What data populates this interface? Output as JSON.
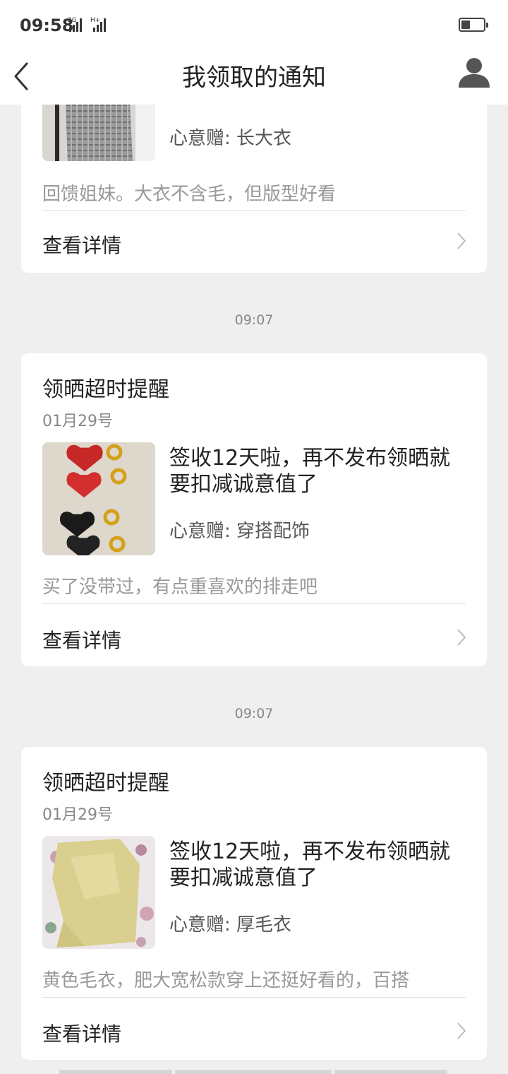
{
  "status_bar": {
    "time": "09:58",
    "network_label_1": "2G",
    "network_label_2": "H+",
    "battery_icon": "battery-icon"
  },
  "header": {
    "title": "我领取的通知",
    "back_icon": "back-arrow-icon",
    "user_icon": "user-icon"
  },
  "cards": [
    {
      "gift": "心意赠: 长大衣",
      "description": "回馈姐妹。大衣不含毛，但版型好看",
      "detail_label": "查看详情",
      "thumb": "coat-photo"
    },
    {
      "time": "09:07",
      "title": "领晒超时提醒",
      "date": "01月29号",
      "headline": "签收12天啦，再不发布领晒就要扣减诚意值了",
      "gift": "心意赠: 穿搭配饰",
      "description": "买了没带过，有点重喜欢的排走吧",
      "detail_label": "查看详情",
      "thumb": "heart-earrings-photo"
    },
    {
      "time": "09:07",
      "title": "领晒超时提醒",
      "date": "01月29号",
      "headline": "签收12天啦，再不发布领晒就要扣减诚意值了",
      "gift": "心意赠: 厚毛衣",
      "description": "黄色毛衣，肥大宽松款穿上还挺好看的，百搭",
      "detail_label": "查看详情",
      "thumb": "yellow-sweater-photo"
    }
  ],
  "colors": {
    "background": "#efefef",
    "card": "#ffffff",
    "muted_text": "#999999"
  }
}
